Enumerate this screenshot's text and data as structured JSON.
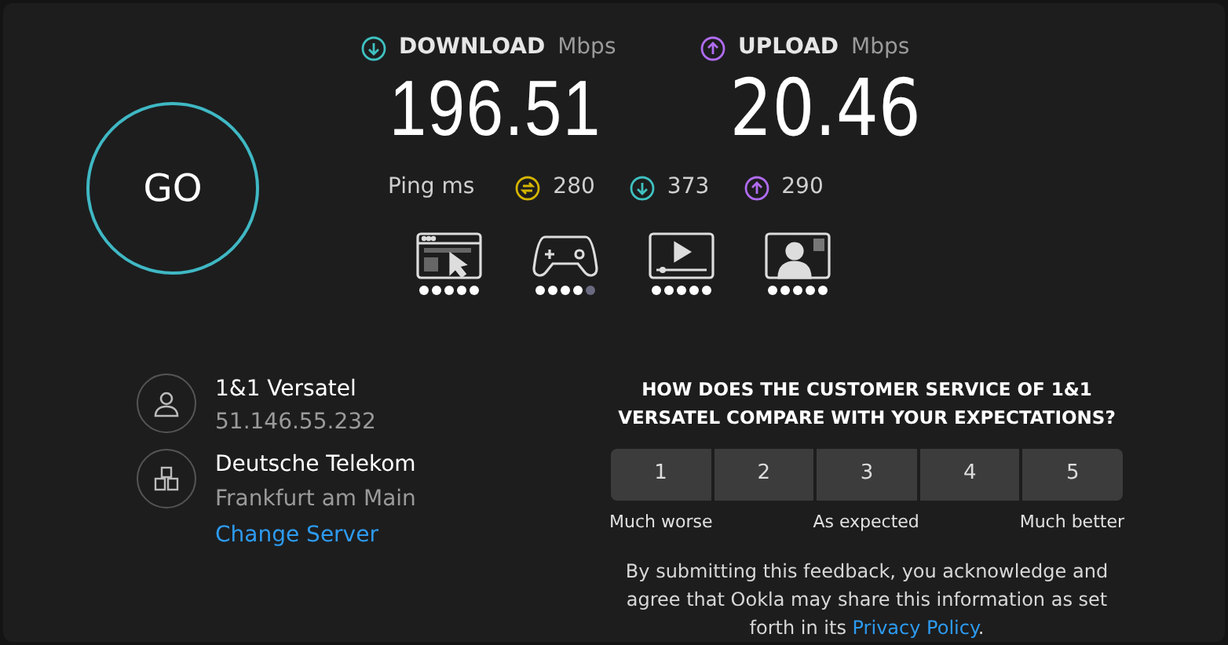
{
  "go_button": "GO",
  "download": {
    "label": "DOWNLOAD",
    "unit": "Mbps",
    "value": "196.51"
  },
  "upload": {
    "label": "UPLOAD",
    "unit": "Mbps",
    "value": "20.46"
  },
  "ping": {
    "label": "Ping ms",
    "values": [
      {
        "kind": "idle",
        "value": "280"
      },
      {
        "kind": "download",
        "value": "373"
      },
      {
        "kind": "upload",
        "value": "290"
      }
    ]
  },
  "ratings": [
    {
      "kind": "browsing",
      "stars": 5
    },
    {
      "kind": "gaming",
      "stars": 4
    },
    {
      "kind": "video",
      "stars": 5
    },
    {
      "kind": "video_call",
      "stars": 5
    }
  ],
  "provider": {
    "name": "1&1 Versatel",
    "ip": "51.146.55.232"
  },
  "server": {
    "name": "Deutsche Telekom",
    "location": "Frankfurt am Main",
    "change_link": "Change Server"
  },
  "survey": {
    "question": "HOW DOES THE CUSTOMER SERVICE OF 1&1 VERSATEL COMPARE WITH YOUR EXPECTATIONS?",
    "options": [
      {
        "label": "1",
        "selected": false
      },
      {
        "label": "2",
        "selected": false
      },
      {
        "label": "3",
        "selected": false
      },
      {
        "label": "4",
        "selected": false
      },
      {
        "label": "5",
        "selected": false
      }
    ],
    "scale_labels": [
      "Much worse",
      "As expected",
      "Much better"
    ],
    "disclaimer_before": "By submitting this feedback, you acknowledge and agree that Ookla may share this information as set forth in its",
    "privacy_link": "Privacy Policy",
    "disclaimer_after": "."
  }
}
